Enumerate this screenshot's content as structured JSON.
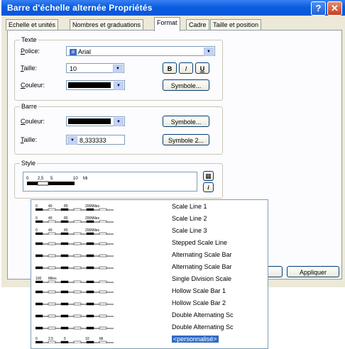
{
  "window": {
    "title": "Barre d'échelle alternée Propriétés",
    "help_glyph": "?",
    "close_glyph": "✕"
  },
  "tabs": [
    {
      "label": "Echelle et unités"
    },
    {
      "label": "Nombres et graduations"
    },
    {
      "label": "Format"
    },
    {
      "label": "Cadre"
    },
    {
      "label": "Taille et position"
    }
  ],
  "texte": {
    "title": "Texte",
    "police_label": "Police:",
    "police_value": "Arial",
    "taille_label": "Taille:",
    "taille_value": "10",
    "bold": "B",
    "italic": "I",
    "underline": "U",
    "couleur_label": "Couleur:",
    "symbole_button": "Symbole..."
  },
  "barre": {
    "title": "Barre",
    "couleur_label": "Couleur:",
    "symbole_button": "Symbole...",
    "taille_label": "Taille:",
    "taille_value": "8,333333",
    "symbole2_button": "Symbole 2..."
  },
  "style": {
    "title": "Style",
    "preview_ticks": [
      "0",
      "2,5",
      "5",
      "10",
      "Mi"
    ]
  },
  "footer": {
    "apply_button": "Appliquer"
  },
  "style_list": [
    {
      "label": "Scale Line 1",
      "ticks": [
        "0",
        "40",
        "80",
        "200Miles"
      ]
    },
    {
      "label": "Scale Line 2",
      "ticks": [
        "0",
        "40",
        "80",
        "200Miles"
      ]
    },
    {
      "label": "Scale Line 3",
      "ticks": [
        "0",
        "40",
        "80",
        "200Miles"
      ]
    },
    {
      "label": "Stepped Scale Line",
      "ticks": []
    },
    {
      "label": "Alternating Scale Bar",
      "ticks": []
    },
    {
      "label": "Alternating Scale Bar",
      "ticks": []
    },
    {
      "label": "Single Division Scale",
      "ticks": [
        "100",
        "Miles"
      ]
    },
    {
      "label": "Hollow Scale Bar 1",
      "ticks": []
    },
    {
      "label": "Hollow Scale Bar 2",
      "ticks": []
    },
    {
      "label": "Double Alternating Sc",
      "ticks": []
    },
    {
      "label": "Double Alternating Sc",
      "ticks": []
    },
    {
      "label": "<personnalisé>",
      "ticks": [
        "0",
        "2,5",
        "5",
        "10",
        "Mi"
      ],
      "selected": true
    }
  ],
  "colors": {
    "title_bar": "#0a5ee0",
    "selection": "#316ac5",
    "dialog_bg": "#ece9d8"
  }
}
